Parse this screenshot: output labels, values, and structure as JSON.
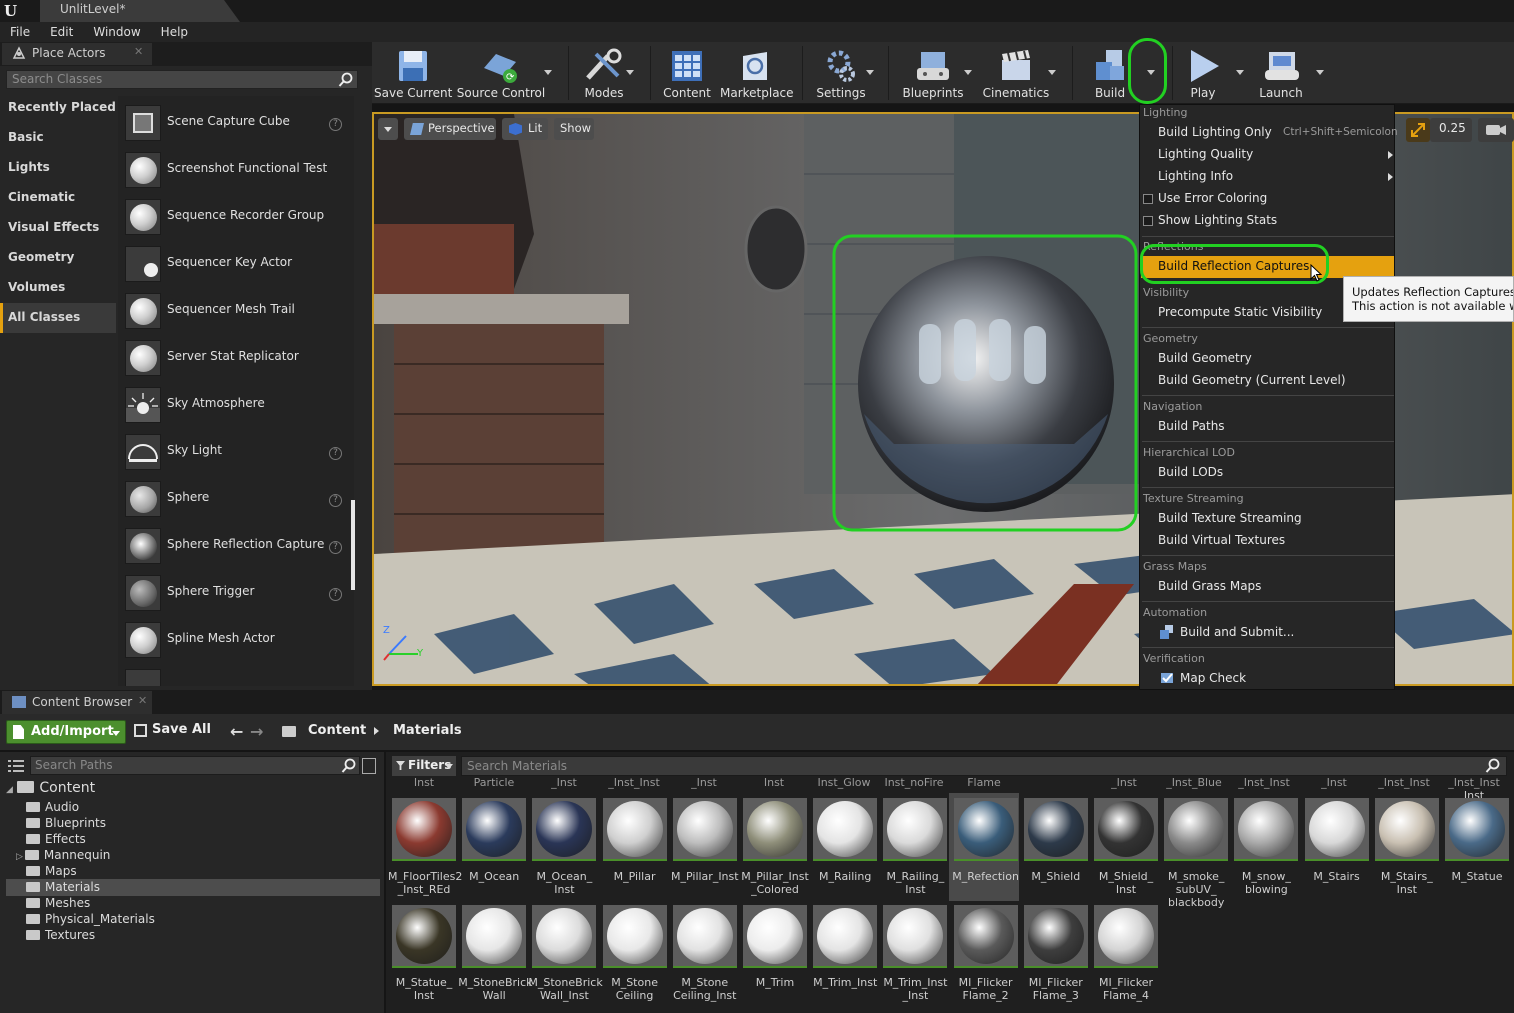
{
  "window": {
    "doc_tab": "UnlitLevel*"
  },
  "menubar": [
    "File",
    "Edit",
    "Window",
    "Help"
  ],
  "place_actors": {
    "tab_title": "Place Actors",
    "search_placeholder": "Search Classes",
    "categories": [
      "Recently Placed",
      "Basic",
      "Lights",
      "Cinematic",
      "Visual Effects",
      "Geometry",
      "Volumes",
      "All Classes"
    ],
    "active_category": "All Classes",
    "actors": [
      {
        "name": "Scene Capture Cube",
        "help": true
      },
      {
        "name": "Screenshot Functional Test",
        "help": false
      },
      {
        "name": "Sequence Recorder Group",
        "help": false
      },
      {
        "name": "Sequencer Key Actor",
        "help": false
      },
      {
        "name": "Sequencer Mesh Trail",
        "help": false
      },
      {
        "name": "Server Stat Replicator",
        "help": false
      },
      {
        "name": "Sky Atmosphere",
        "help": false
      },
      {
        "name": "Sky Light",
        "help": true
      },
      {
        "name": "Sphere",
        "help": true
      },
      {
        "name": "Sphere Reflection Capture",
        "help": true
      },
      {
        "name": "Sphere Trigger",
        "help": true
      },
      {
        "name": "Spline Mesh Actor",
        "help": false
      }
    ]
  },
  "toolbar": {
    "save_current": "Save Current",
    "source_control": "Source Control",
    "modes": "Modes",
    "content": "Content",
    "marketplace": "Marketplace",
    "settings": "Settings",
    "blueprints": "Blueprints",
    "cinematics": "Cinematics",
    "build": "Build",
    "play": "Play",
    "launch": "Launch"
  },
  "viewport": {
    "perspective": "Perspective",
    "lit": "Lit",
    "show": "Show",
    "snap_value": "0.25",
    "axis_z": "Z",
    "axis_y": "Y"
  },
  "build_menu": {
    "lighting_header": "Lighting",
    "build_lighting_only": "Build Lighting Only",
    "build_lighting_shortcut": "Ctrl+Shift+Semicolon",
    "lighting_quality": "Lighting Quality",
    "lighting_info": "Lighting Info",
    "use_error_coloring": "Use Error Coloring",
    "show_lighting_stats": "Show Lighting Stats",
    "reflections_header": "Reflections",
    "build_reflection_captures": "Build Reflection Captures",
    "visibility_header": "Visibility",
    "precompute_static_visibility": "Precompute Static Visibility",
    "geometry_header": "Geometry",
    "build_geometry": "Build Geometry",
    "build_geometry_current": "Build Geometry (Current Level)",
    "navigation_header": "Navigation",
    "build_paths": "Build Paths",
    "hlod_header": "Hierarchical LOD",
    "build_lods": "Build LODs",
    "texture_streaming_header": "Texture Streaming",
    "build_texture_streaming": "Build Texture Streaming",
    "build_virtual_textures": "Build Virtual Textures",
    "grass_maps_header": "Grass Maps",
    "build_grass_maps": "Build Grass Maps",
    "automation_header": "Automation",
    "build_and_submit": "Build and Submit...",
    "verification_header": "Verification",
    "map_check": "Map Check"
  },
  "tooltip": {
    "line1": "Updates Reflection Captures a",
    "line2": "This action is not available wh"
  },
  "content_browser": {
    "tab_title": "Content Browser",
    "add_import": "Add/Import",
    "save_all": "Save All",
    "breadcrumb": [
      "Content",
      "Materials"
    ],
    "search_paths_placeholder": "Search Paths",
    "filters": "Filters",
    "search_materials_placeholder": "Search Materials",
    "tree": {
      "root": "Content",
      "folders": [
        "Audio",
        "Blueprints",
        "Effects",
        "Mannequin",
        "Maps",
        "Materials",
        "Meshes",
        "Physical_Materials",
        "Textures"
      ],
      "selected": "Materials"
    },
    "top_row_labels": [
      "Inst",
      "Particle",
      "_Inst",
      "_Inst_Inst",
      "_Inst",
      "Inst",
      "Inst_Glow",
      "Inst_noFire",
      "Flame",
      "",
      "_Inst",
      "_Inst_Blue",
      "_Inst_Inst",
      "_Inst",
      "_Inst_Inst",
      "_Inst_Inst"
    ],
    "top_row_last_extra": "Inst",
    "assets_row1": [
      {
        "label": "M_FloorTiles2\n_Inst_REd",
        "color": "#8b3a30"
      },
      {
        "label": "M_Ocean",
        "color": "#2b3b5c"
      },
      {
        "label": "M_Ocean_\nInst",
        "color": "#2a3556"
      },
      {
        "label": "M_Pillar",
        "color": "#cfcfcf"
      },
      {
        "label": "M_Pillar_Inst",
        "color": "#bdbdbd"
      },
      {
        "label": "M_Pillar_Inst\n_Colored",
        "color": "#8f8f7a"
      },
      {
        "label": "M_Railing",
        "color": "#e4e4e4"
      },
      {
        "label": "M_Railing_\nInst",
        "color": "#dadada"
      },
      {
        "label": "M_Refection",
        "color": "#3a5d7a"
      },
      {
        "label": "M_Shield",
        "color": "#2d3a4a"
      },
      {
        "label": "M_Shield_\nInst",
        "color": "#333333"
      },
      {
        "label": "M_smoke_\nsubUV_\nblackbody",
        "color": "#8a8a8a"
      },
      {
        "label": "M_snow_\nblowing",
        "color": "#a9a9a9"
      },
      {
        "label": "M_Stairs",
        "color": "#d8d8d8"
      },
      {
        "label": "M_Stairs_\nInst",
        "color": "#c9c0b2"
      },
      {
        "label": "M_Statue",
        "color": "#4a6a88"
      }
    ],
    "assets_row2": [
      {
        "label": "M_Statue_\nInst",
        "color": "#3a3626"
      },
      {
        "label": "M_StoneBrick\nWall",
        "color": "#e6e6e6"
      },
      {
        "label": "M_StoneBrick\nWall_Inst",
        "color": "#dcdcdc"
      },
      {
        "label": "M_Stone\nCeiling",
        "color": "#e8e8e8"
      },
      {
        "label": "M_Stone\nCeiling_Inst",
        "color": "#e2e2e2"
      },
      {
        "label": "M_Trim",
        "color": "#ececec"
      },
      {
        "label": "M_Trim_Inst",
        "color": "#e4e4e4"
      },
      {
        "label": "M_Trim_Inst\n_Inst",
        "color": "#e0e0e0"
      },
      {
        "label": "MI_Flicker\nFlame_2",
        "color": "#5a5a5a"
      },
      {
        "label": "MI_Flicker\nFlame_3",
        "color": "#3e3e3e"
      },
      {
        "label": "MI_Flicker\nFlame_4",
        "color": "#d4d4d4"
      }
    ]
  },
  "colors": {
    "accent": "#e5a10f",
    "highlight_green": "#22d022",
    "add_button": "#4c8f2e",
    "menu_highlight": "#e5a10f"
  }
}
